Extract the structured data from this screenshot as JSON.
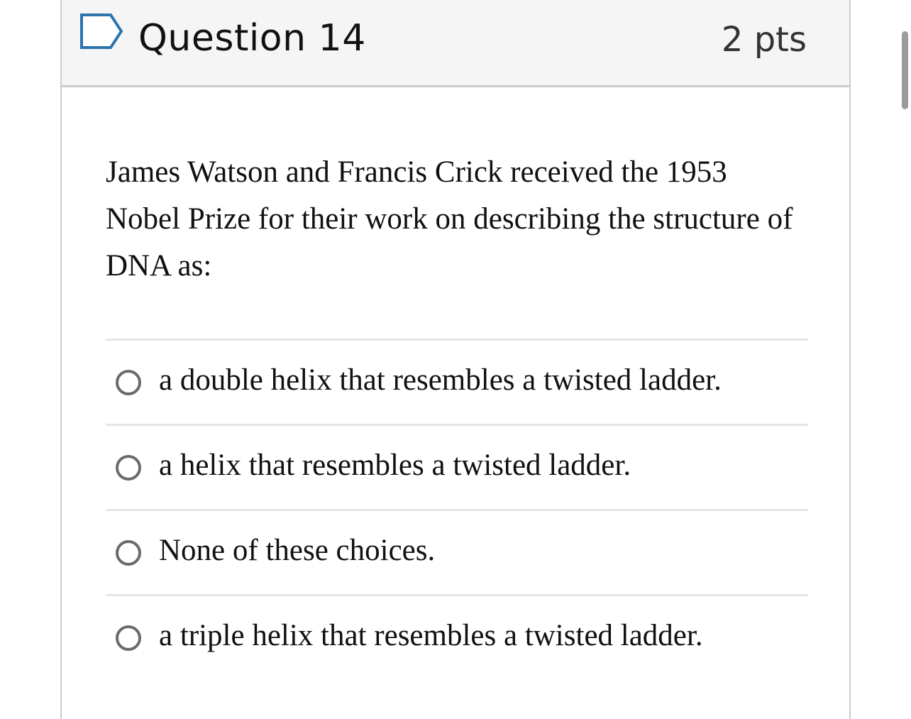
{
  "question": {
    "title": "Question 14",
    "points": "2 pts",
    "flag_icon": "flag-outline-icon",
    "text": "James Watson and Francis Crick received the 1953 Nobel Prize for their work on describing the structure of DNA as:"
  },
  "answers": [
    {
      "label": "a double helix that resembles a twisted ladder.",
      "selected": false
    },
    {
      "label": "a helix that resembles a twisted ladder.",
      "selected": false
    },
    {
      "label": "None of these choices.",
      "selected": false
    },
    {
      "label": "a triple helix that resembles a twisted ladder.",
      "selected": false
    }
  ],
  "colors": {
    "header_background": "#f5f5f5",
    "border": "#c7cdd1",
    "flag_stroke": "#2d74ad",
    "radio_border": "#6b6b6b",
    "divider": "#e3e6e8"
  }
}
